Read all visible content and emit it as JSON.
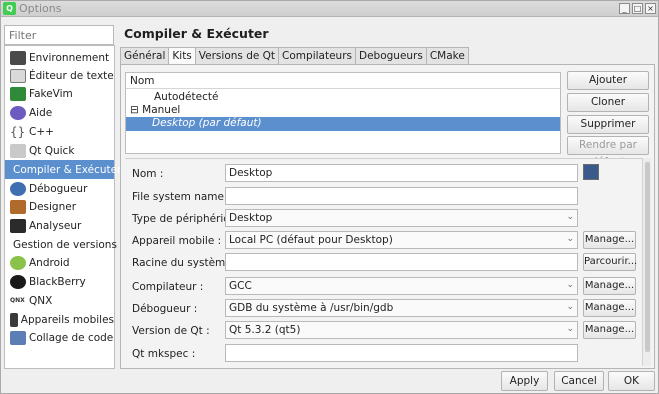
{
  "window": {
    "title": "Options",
    "app_icon": "qt-creator-icon",
    "controls": [
      "_",
      "□",
      "×"
    ]
  },
  "filter": {
    "placeholder": "Filter"
  },
  "sidebar": {
    "items": [
      {
        "label": "Environnement",
        "icon": "monitor-icon",
        "color": "#4a4a4a"
      },
      {
        "label": "Éditeur de texte",
        "icon": "text-editor-icon",
        "color": "#7b7b7b"
      },
      {
        "label": "FakeVim",
        "icon": "fakevim-icon",
        "color": "#2f8a3a"
      },
      {
        "label": "Aide",
        "icon": "help-icon",
        "color": "#6e5bbf"
      },
      {
        "label": "C++",
        "icon": "braces-icon",
        "color": "#5a5a5a"
      },
      {
        "label": "Qt Quick",
        "icon": "qtquick-icon",
        "color": "#8c8c8c"
      },
      {
        "label": "Compiler & Exécuter",
        "icon": "build-run-icon",
        "color": "#41cd52",
        "selected": true
      },
      {
        "label": "Débogueur",
        "icon": "debugger-icon",
        "color": "#3f6fb0"
      },
      {
        "label": "Designer",
        "icon": "designer-icon",
        "color": "#b06a2c"
      },
      {
        "label": "Analyseur",
        "icon": "analyzer-icon",
        "color": "#2b2b2b"
      },
      {
        "label": "Gestion de versions",
        "icon": "version-control-icon",
        "color": "#c8a24a"
      },
      {
        "label": "Android",
        "icon": "android-icon",
        "color": "#8bc34a"
      },
      {
        "label": "BlackBerry",
        "icon": "blackberry-icon",
        "color": "#1a1a1a"
      },
      {
        "label": "QNX",
        "icon": "qnx-icon",
        "color": "#333333"
      },
      {
        "label": "Appareils mobiles",
        "icon": "mobile-device-icon",
        "color": "#3a3a3a"
      },
      {
        "label": "Collage de code",
        "icon": "code-paste-icon",
        "color": "#5b7fb5"
      }
    ]
  },
  "main": {
    "title": "Compiler & Exécuter",
    "tabs": [
      {
        "label": "Général"
      },
      {
        "label": "Kits",
        "active": true
      },
      {
        "label": "Versions de Qt"
      },
      {
        "label": "Compilateurs"
      },
      {
        "label": "Debogueurs"
      },
      {
        "label": "CMake"
      }
    ],
    "tree": {
      "header": "Nom",
      "rows": [
        {
          "label": "Autodétecté"
        },
        {
          "label": "⊟ Manuel"
        },
        {
          "label": "Desktop (par défaut)",
          "selected": true
        }
      ]
    },
    "buttons": {
      "add": "Ajouter",
      "clone": "Cloner",
      "remove": "Supprimer",
      "make_default": "Rendre par défaut"
    },
    "form": {
      "name_label": "Nom :",
      "name_value": "Desktop",
      "fs_label": "File system name:",
      "fs_value": "",
      "device_type_label": "Type de périphérique :",
      "device_type_value": "Desktop",
      "device_label": "Appareil mobile :",
      "device_value": "Local PC (défaut pour Desktop)",
      "sysroot_label": "Racine du système :",
      "sysroot_value": "",
      "compiler_label": "Compilateur :",
      "compiler_value": "GCC",
      "debugger_label": "Débogueur :",
      "debugger_value": "GDB du système à /usr/bin/gdb",
      "qt_version_label": "Version de Qt :",
      "qt_version_value": "Qt 5.3.2 (qt5)",
      "mkspec_label": "Qt mkspec :",
      "mkspec_value": "",
      "manage": "Manage...",
      "browse": "Parcourir..."
    }
  },
  "footer": {
    "apply": "Apply",
    "cancel": "Cancel",
    "ok": "OK"
  }
}
